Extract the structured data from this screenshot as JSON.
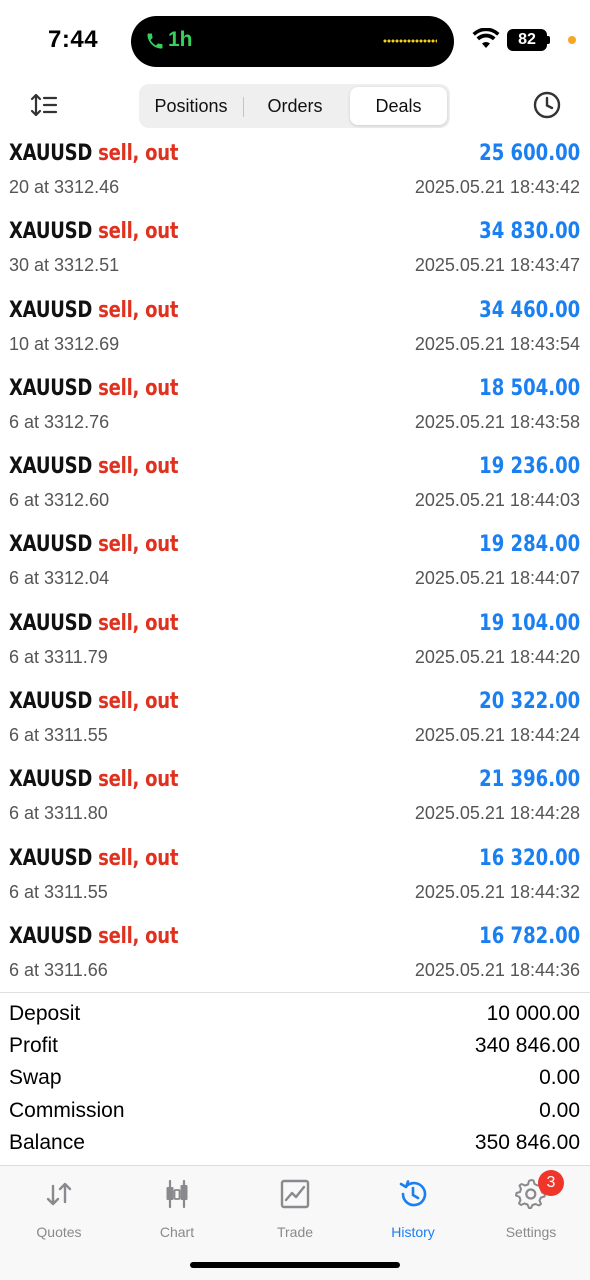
{
  "status_bar": {
    "time": "7:44",
    "call_timer": "1h",
    "battery_level": "82",
    "colors": {
      "call_green": "#35d15a",
      "dot_orange": "#f5a623"
    }
  },
  "toolbar": {
    "segments": [
      {
        "label": "Positions",
        "selected": false
      },
      {
        "label": "Orders",
        "selected": false
      },
      {
        "label": "Deals",
        "selected": true
      }
    ],
    "left_icon": "sort-icon",
    "right_icon": "history-clock-icon"
  },
  "deals": [
    {
      "symbol": "XAUUSD",
      "direction": "sell, out",
      "profit": "25 600.00",
      "volume_price": "20 at 3312.46",
      "time": "2025.05.21 18:43:42"
    },
    {
      "symbol": "XAUUSD",
      "direction": "sell, out",
      "profit": "34 830.00",
      "volume_price": "30 at 3312.51",
      "time": "2025.05.21 18:43:47"
    },
    {
      "symbol": "XAUUSD",
      "direction": "sell, out",
      "profit": "34 460.00",
      "volume_price": "10 at 3312.69",
      "time": "2025.05.21 18:43:54"
    },
    {
      "symbol": "XAUUSD",
      "direction": "sell, out",
      "profit": "18 504.00",
      "volume_price": "6 at 3312.76",
      "time": "2025.05.21 18:43:58"
    },
    {
      "symbol": "XAUUSD",
      "direction": "sell, out",
      "profit": "19 236.00",
      "volume_price": "6 at 3312.60",
      "time": "2025.05.21 18:44:03"
    },
    {
      "symbol": "XAUUSD",
      "direction": "sell, out",
      "profit": "19 284.00",
      "volume_price": "6 at 3312.04",
      "time": "2025.05.21 18:44:07"
    },
    {
      "symbol": "XAUUSD",
      "direction": "sell, out",
      "profit": "19 104.00",
      "volume_price": "6 at 3311.79",
      "time": "2025.05.21 18:44:20"
    },
    {
      "symbol": "XAUUSD",
      "direction": "sell, out",
      "profit": "20 322.00",
      "volume_price": "6 at 3311.55",
      "time": "2025.05.21 18:44:24"
    },
    {
      "symbol": "XAUUSD",
      "direction": "sell, out",
      "profit": "21 396.00",
      "volume_price": "6 at 3311.80",
      "time": "2025.05.21 18:44:28"
    },
    {
      "symbol": "XAUUSD",
      "direction": "sell, out",
      "profit": "16 320.00",
      "volume_price": "6 at 3311.55",
      "time": "2025.05.21 18:44:32"
    },
    {
      "symbol": "XAUUSD",
      "direction": "sell, out",
      "profit": "16 782.00",
      "volume_price": "6 at 3311.66",
      "time": "2025.05.21 18:44:36"
    }
  ],
  "summary": [
    {
      "label": "Deposit",
      "value": "10 000.00"
    },
    {
      "label": "Profit",
      "value": "340 846.00"
    },
    {
      "label": "Swap",
      "value": "0.00"
    },
    {
      "label": "Commission",
      "value": "0.00"
    },
    {
      "label": "Balance",
      "value": "350 846.00"
    }
  ],
  "tabbar": {
    "tabs": [
      {
        "label": "Quotes",
        "icon": "quotes-icon",
        "active": false
      },
      {
        "label": "Chart",
        "icon": "chart-icon",
        "active": false
      },
      {
        "label": "Trade",
        "icon": "trade-icon",
        "active": false
      },
      {
        "label": "History",
        "icon": "history-icon",
        "active": true
      },
      {
        "label": "Settings",
        "icon": "settings-icon",
        "active": false
      }
    ],
    "settings_badge": "3"
  },
  "colors": {
    "profit_blue": "#1a7ff0",
    "sell_red": "#e0301e",
    "active_tab": "#1a7ff0",
    "badge_red": "#f0362b"
  }
}
